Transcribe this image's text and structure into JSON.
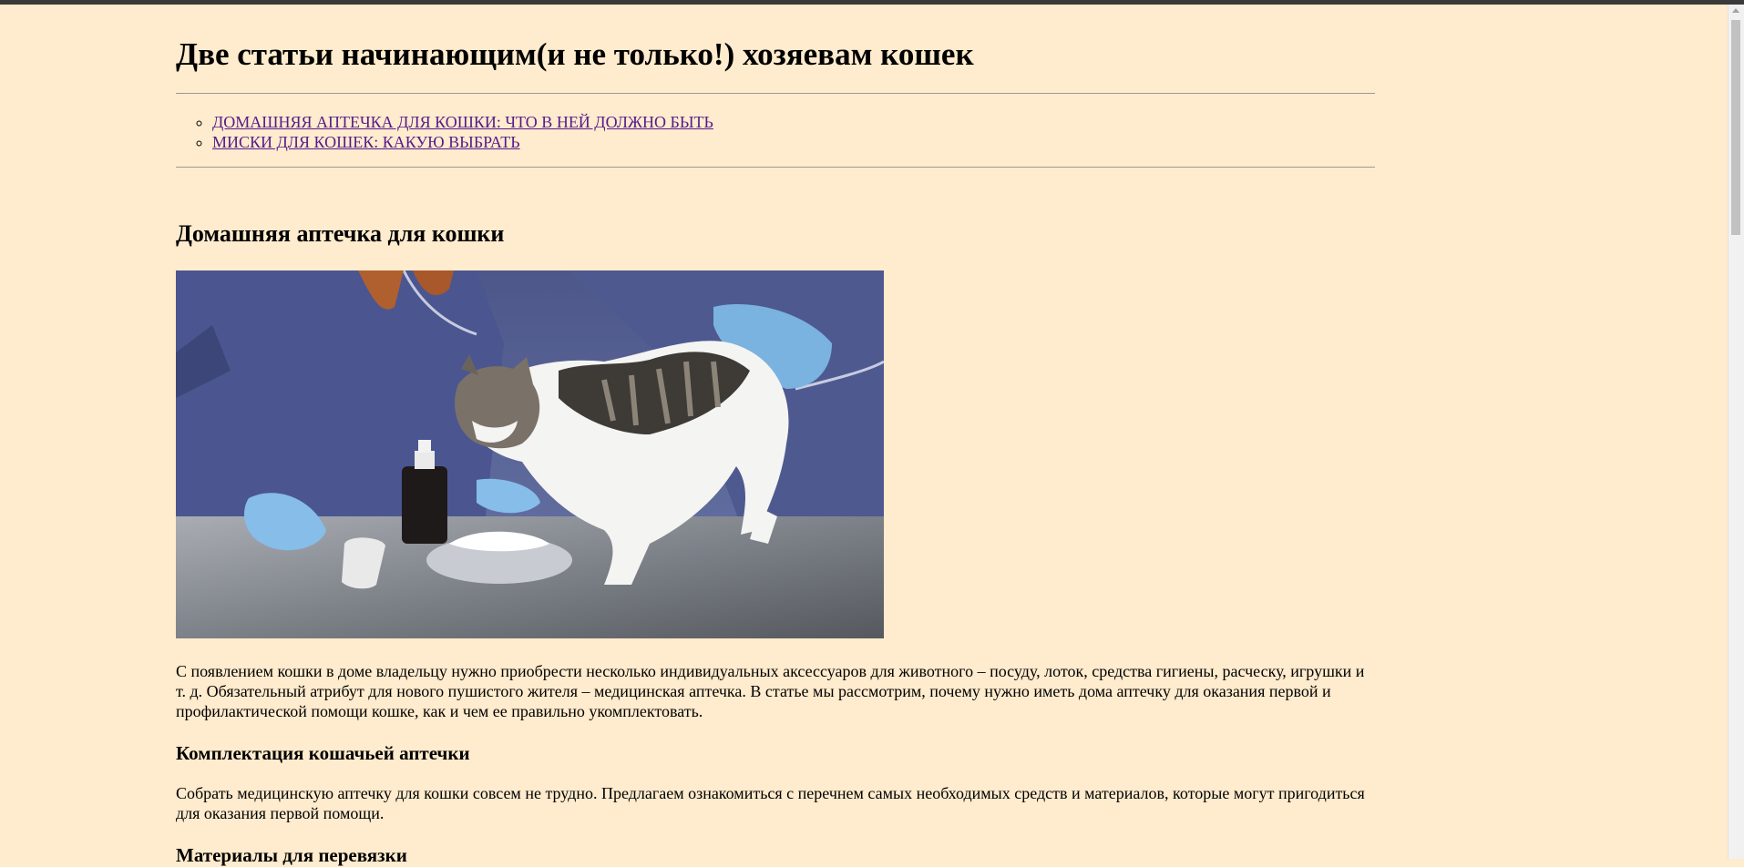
{
  "page": {
    "title": "Две статьи начинающим(и не только!) хозяевам кошек"
  },
  "toc": {
    "items": [
      {
        "label": "ДОМАШНЯЯ АПТЕЧКА ДЛЯ КОШКИ: ЧТО В НЕЙ ДОЛЖНО БЫТЬ"
      },
      {
        "label": "МИСКИ ДЛЯ КОШЕК: КАКУЮ ВЫБРАТЬ"
      }
    ]
  },
  "article": {
    "heading": "Домашняя аптечка для кошки",
    "intro": "С появлением кошки в доме владельцу нужно приобрести несколько индивидуальных аксессуаров для животного – посуду, лоток, средства гигиены, расческу, игрушки и т. д. Обязательный атрибут для нового пушистого жителя – медицинская аптечка. В статье мы рассмотрим, почему нужно иметь дома аптечку для оказания первой и профилактической помощи кошке, как и чем ее правильно укомплектовать.",
    "section1_heading": "Комплектация кошачьей аптечки",
    "section1_text": "Собрать медицинскую аптечку для кошки совсем не трудно. Предлагаем ознакомиться с перечнем самых необходимых средств и материалов, которые могут пригодиться для оказания первой помощи.",
    "section2_heading": "Материалы для перевязки"
  },
  "colors": {
    "background": "#ffebcd",
    "link_visited": "#551a8b",
    "scrubs": "#5e6a9e",
    "gloves": "#7ab2e0",
    "table": "#8f9399"
  },
  "icons": {
    "scroll_up": "chevron-up-icon"
  }
}
